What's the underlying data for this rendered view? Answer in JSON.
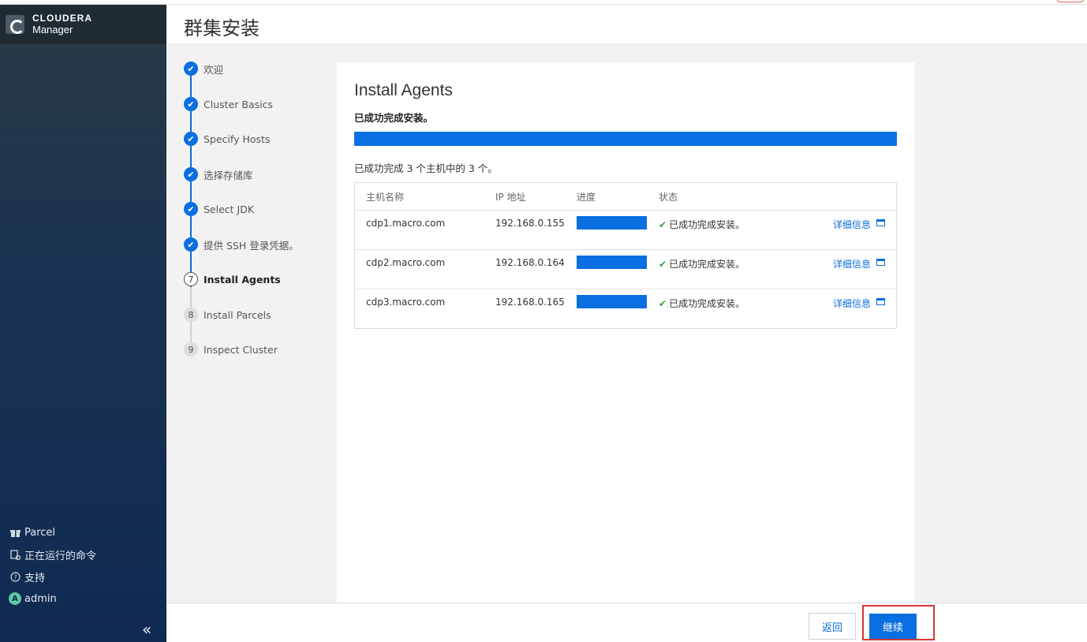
{
  "brand": {
    "line1": "CLOUDERA",
    "line2": "Manager"
  },
  "page_title": "群集安装",
  "steps": [
    {
      "label": "欢迎",
      "state": "done"
    },
    {
      "label": "Cluster Basics",
      "state": "done"
    },
    {
      "label": "Specify Hosts",
      "state": "done"
    },
    {
      "label": "选择存储库",
      "state": "done"
    },
    {
      "label": "Select JDK",
      "state": "done"
    },
    {
      "label": "提供 SSH 登录凭据。",
      "state": "done"
    },
    {
      "label": "Install Agents",
      "state": "current",
      "num": "7"
    },
    {
      "label": "Install Parcels",
      "state": "todo",
      "num": "8"
    },
    {
      "label": "Inspect Cluster",
      "state": "todo",
      "num": "9"
    }
  ],
  "content": {
    "title": "Install Agents",
    "status": "已成功完成安装。",
    "progress_percent": 100,
    "summary": "已成功完成 3 个主机中的 3 个。",
    "columns": {
      "host": "主机名称",
      "ip": "IP 地址",
      "progress": "进度",
      "status": "状态"
    },
    "rows": [
      {
        "host": "cdp1.macro.com",
        "ip": "192.168.0.155",
        "progress_percent": 100,
        "status": "已成功完成安装。",
        "detail": "详细信息"
      },
      {
        "host": "cdp2.macro.com",
        "ip": "192.168.0.164",
        "progress_percent": 100,
        "status": "已成功完成安装。",
        "detail": "详细信息"
      },
      {
        "host": "cdp3.macro.com",
        "ip": "192.168.0.165",
        "progress_percent": 100,
        "status": "已成功完成安装。",
        "detail": "详细信息"
      }
    ]
  },
  "sidebar_bottom": {
    "parcel": "Parcel",
    "running_commands": "正在运行的命令",
    "support": "支持",
    "user": "admin",
    "user_initial": "A",
    "collapse": "«"
  },
  "footer": {
    "back": "返回",
    "next": "继续"
  },
  "colors": {
    "accent": "#0a6fe0",
    "success": "#3b9a3b",
    "highlight": "#d93434"
  }
}
